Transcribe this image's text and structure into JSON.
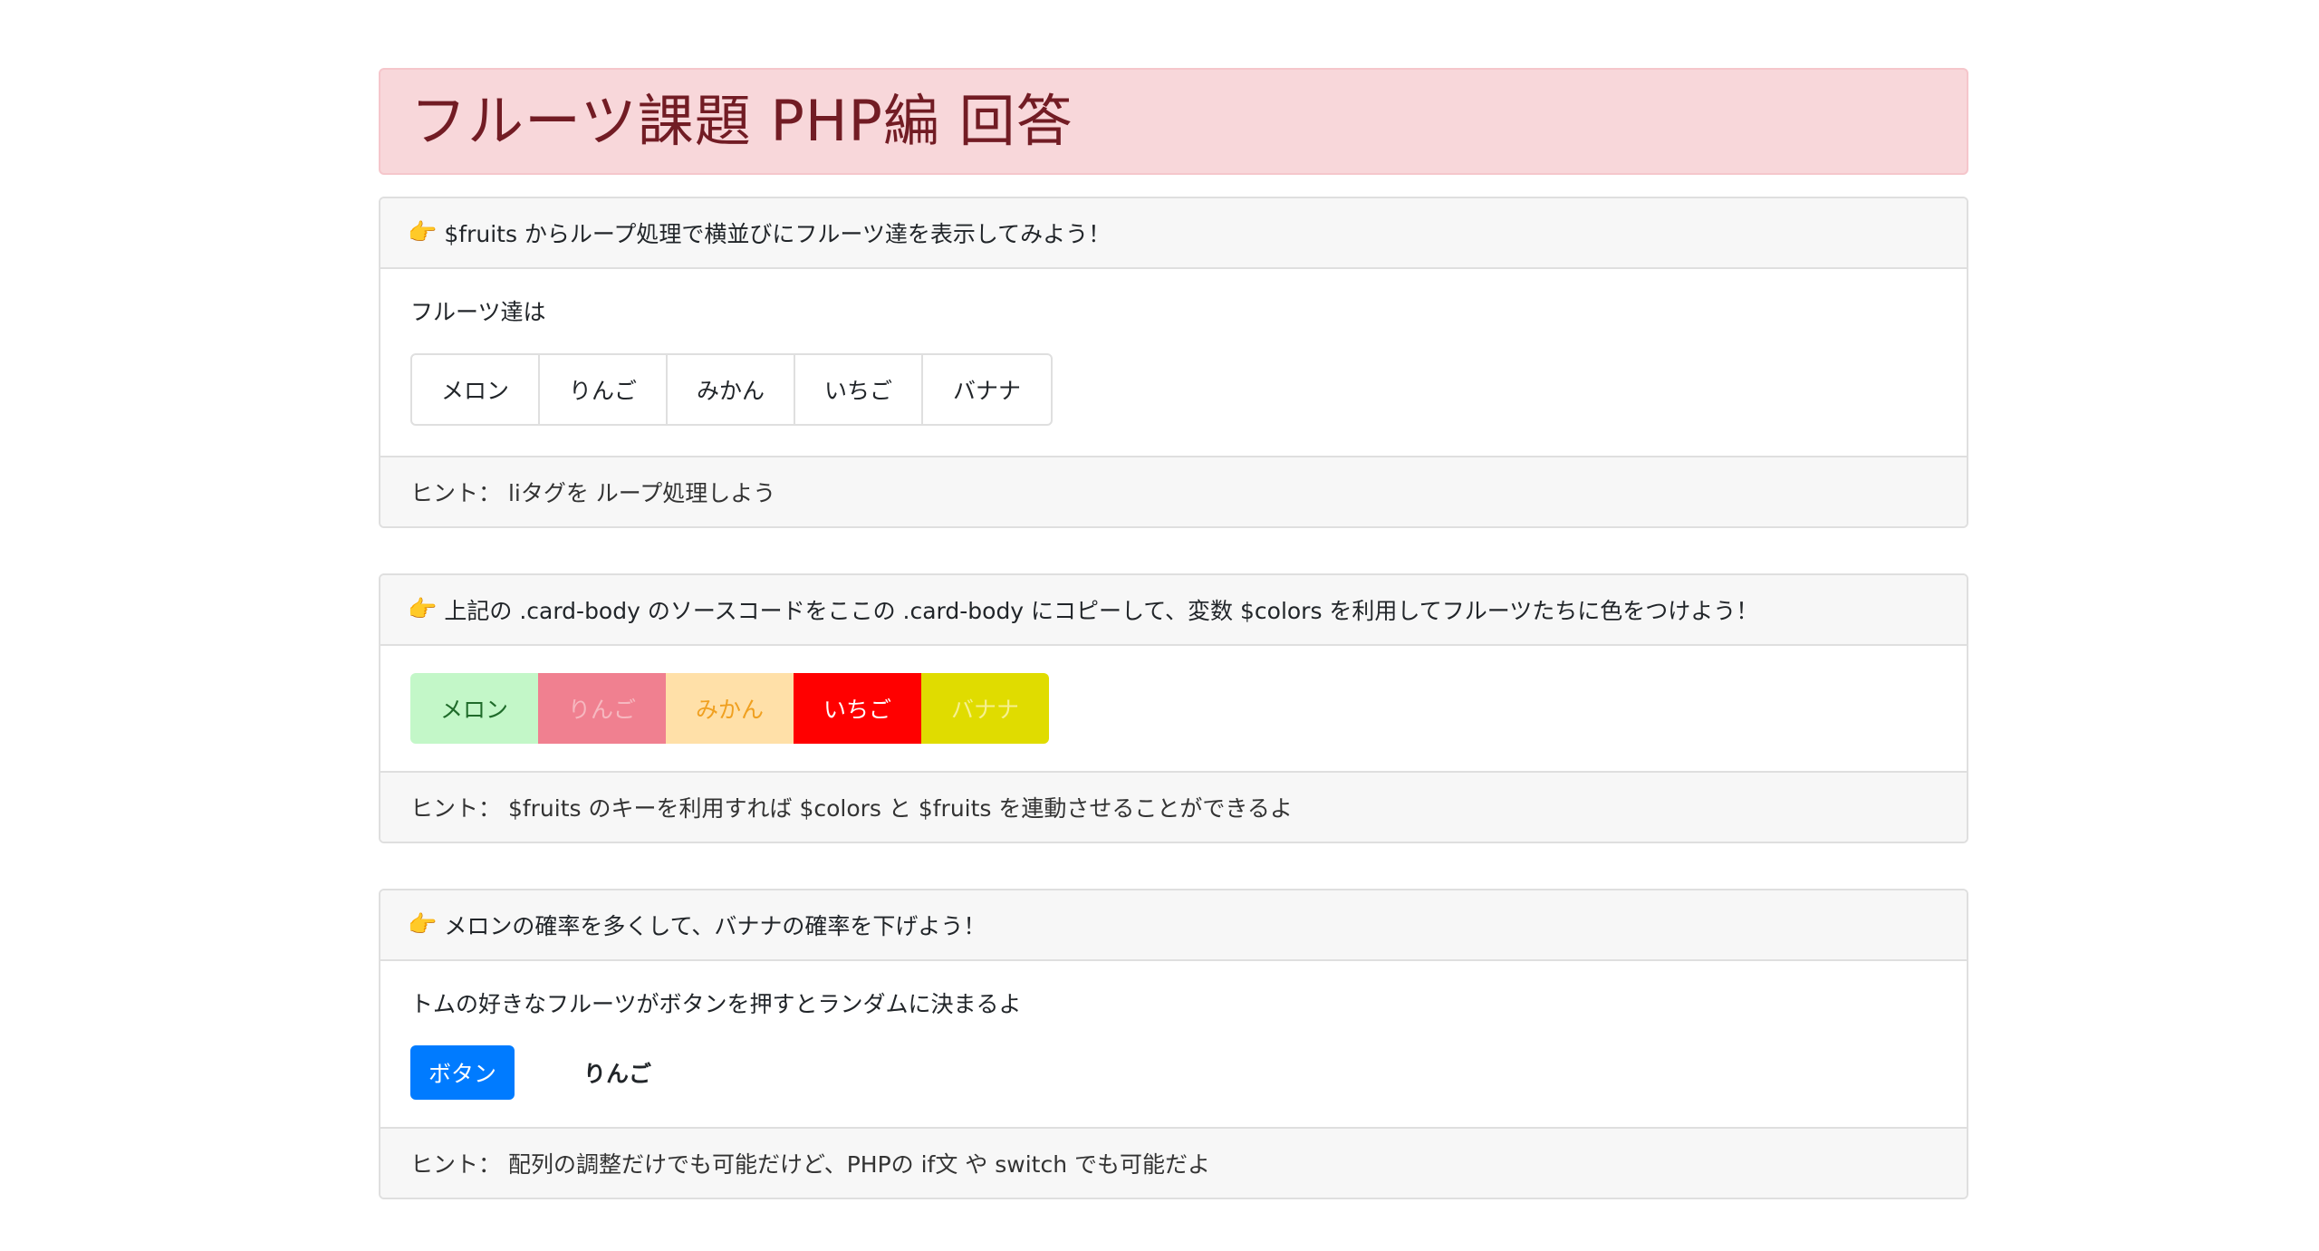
{
  "title": "フルーツ課題 PHP編 回答",
  "card1": {
    "header": "$fruits からループ処理で横並びにフルーツ達を表示してみよう！",
    "intro": "フルーツ達は",
    "fruits": [
      "メロン",
      "りんご",
      "みかん",
      "いちご",
      "バナナ"
    ],
    "hint": "ヒント： liタグを ループ処理しよう"
  },
  "card2": {
    "header": "上記の .card-body のソースコードをここの .card-body にコピーして、変数 $colors を利用してフルーツたちに色をつけよう！",
    "fruits": [
      "メロン",
      "りんご",
      "みかん",
      "いちご",
      "バナナ"
    ],
    "colors": {
      "melon_bg": "#c3f7c8",
      "melon_fg": "#1f6b2a",
      "apple_bg": "#f08090",
      "apple_fg": "#f6b8c0",
      "orange_bg": "#ffe0a8",
      "orange_fg": "#f0a020",
      "strawberry_bg": "#ff0000",
      "strawberry_fg": "#ffffff",
      "banana_bg": "#e0dc00",
      "banana_fg": "#f6f090"
    },
    "hint": "ヒント： $fruits のキーを利用すれば $colors と $fruits を連動させることができるよ"
  },
  "card3": {
    "header": "メロンの確率を多くして、バナナの確率を下げよう！",
    "intro": "トムの好きなフルーツがボタンを押すとランダムに決まるよ",
    "button_label": "ボタン",
    "result": "りんご",
    "hint": "ヒント： 配列の調整だけでも可能だけど、PHPの if文 や switch でも可能だよ"
  },
  "icons": {
    "header_icon": "pointing-hand-icon"
  }
}
